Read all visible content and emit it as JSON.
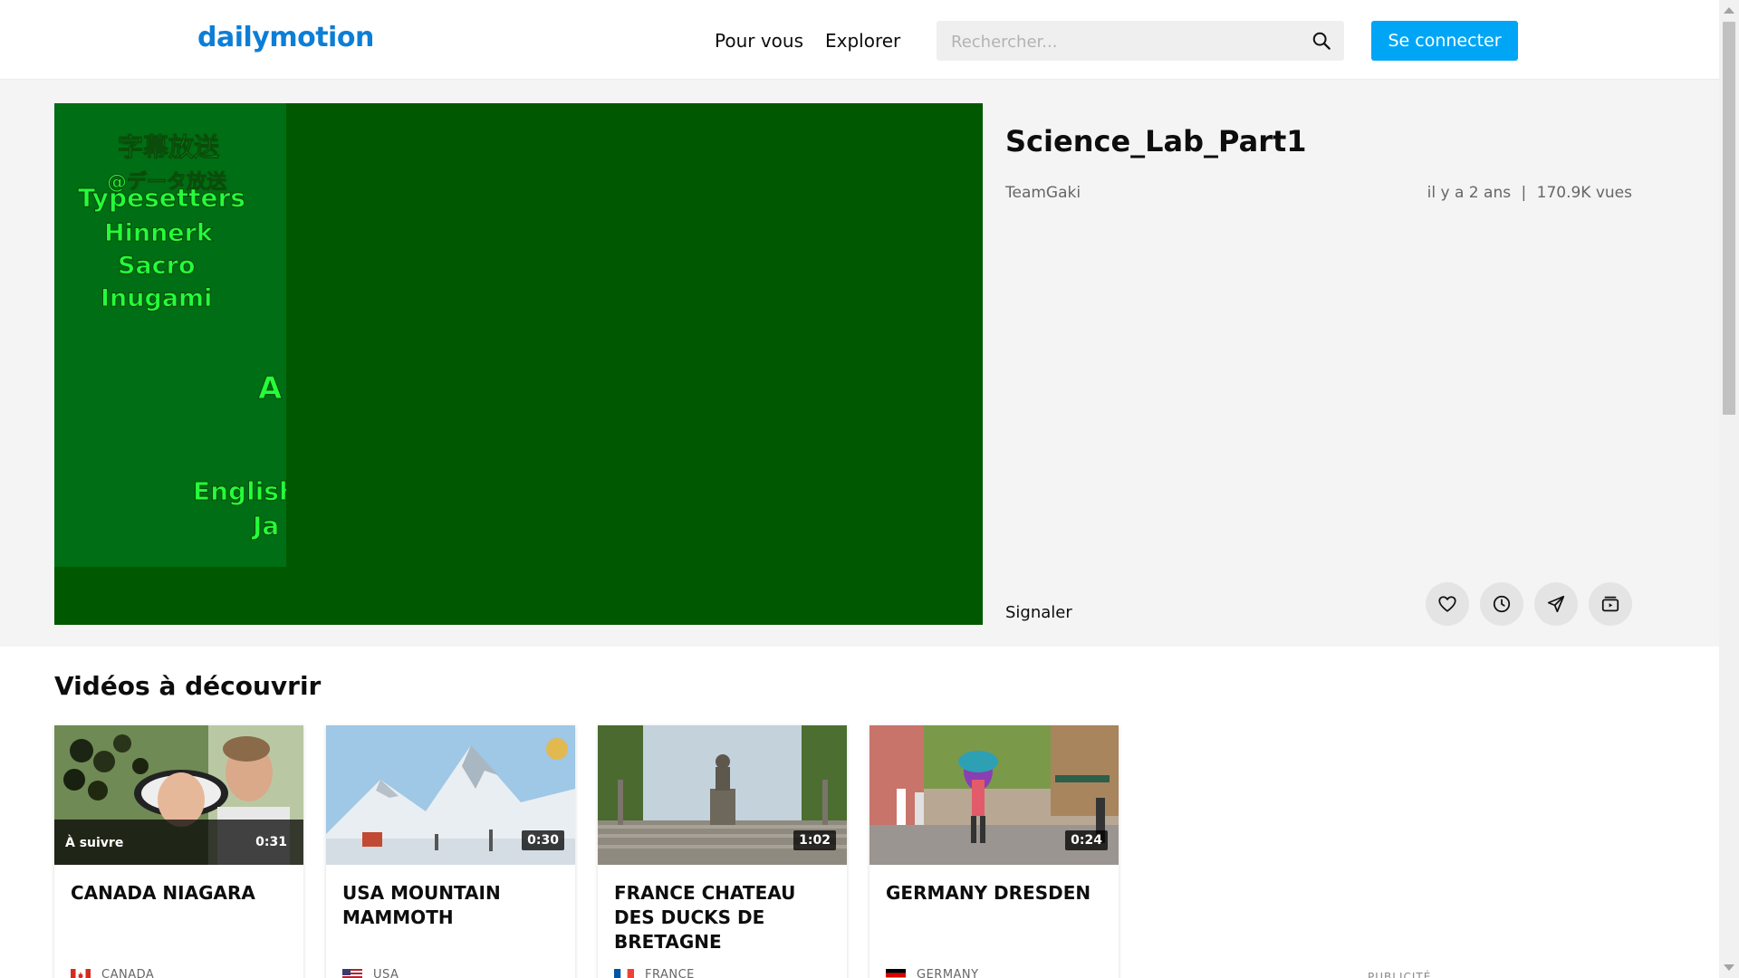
{
  "header": {
    "logo_text": "dailymotion",
    "nav": [
      {
        "label": "Pour vous"
      },
      {
        "label": "Explorer"
      }
    ],
    "search": {
      "placeholder": "Rechercher...",
      "value": ""
    },
    "signin_label": "Se connecter"
  },
  "colors": {
    "brand": "#0d7ed6",
    "signin_button": "#00a6f5",
    "player_background": "#005900",
    "credits_text": "#24ff3a"
  },
  "player": {
    "credits": [
      "字幕放送",
      "@データ放送",
      "Typesetters",
      "Hinnerk",
      "Sacro",
      "Inugami",
      "A",
      "English",
      "Ja"
    ]
  },
  "video": {
    "title": "Science_Lab_Part1",
    "channel": "TeamGaki",
    "age": "il y a 2 ans",
    "views": "170.9K vues",
    "report_label": "Signaler",
    "actions": [
      {
        "icon": "heart-icon"
      },
      {
        "icon": "clock-icon"
      },
      {
        "icon": "share-icon"
      },
      {
        "icon": "playlist-icon"
      }
    ]
  },
  "discover": {
    "title": "Vidéos à découvrir",
    "next_label": "À suivre",
    "cards": [
      {
        "title": "CANADA NIAGARA",
        "duration": "0:31",
        "country": "CANADA"
      },
      {
        "title": "USA MOUNTAIN MAMMOTH",
        "duration": "0:30",
        "country": "USA"
      },
      {
        "title": "FRANCE CHATEAU DES DUCKS DE BRETAGNE",
        "duration": "1:02",
        "country": "FRANCE"
      },
      {
        "title": "GERMANY DRESDEN",
        "duration": "0:24",
        "country": "GERMANY"
      }
    ]
  },
  "ad_label": "PUBLICITÉ"
}
